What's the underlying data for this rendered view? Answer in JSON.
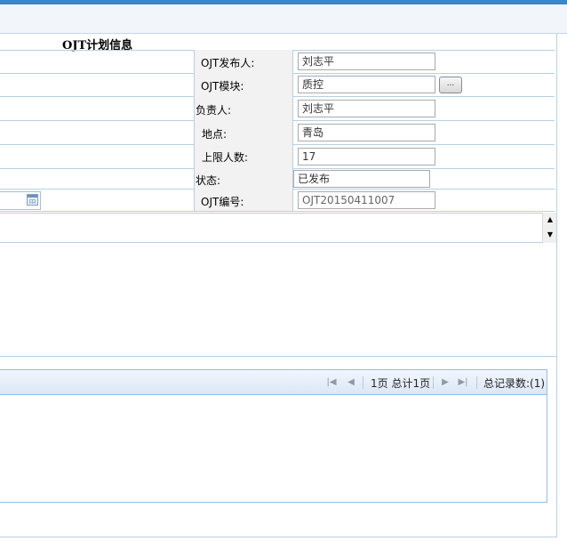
{
  "form": {
    "title": "OJT计划信息",
    "fields": [
      {
        "label": "OJT发布人:",
        "value": "刘志平"
      },
      {
        "label": "OJT模块:",
        "value": "质控",
        "button": "..."
      },
      {
        "label": "负责人:",
        "value": "刘志平"
      },
      {
        "label": "地点:",
        "value": "青岛"
      },
      {
        "label": "上限人数:",
        "value": "17"
      },
      {
        "label": "状态:",
        "value": "已发布"
      },
      {
        "label": "OJT编号:",
        "value": "OJT20150411007"
      }
    ]
  },
  "pager": {
    "page_text": "1页 总计1页",
    "record_text": "总记录数:(1)"
  },
  "icons": [
    "calendar-icon",
    "scroll-up-icon",
    "scroll-down-icon",
    "first-page-icon",
    "prev-page-icon",
    "next-page-icon",
    "last-page-icon"
  ],
  "colors": {
    "accent": "#3c86c9",
    "border": "#b8cfe6",
    "label_bg": "#f2f2f2"
  }
}
